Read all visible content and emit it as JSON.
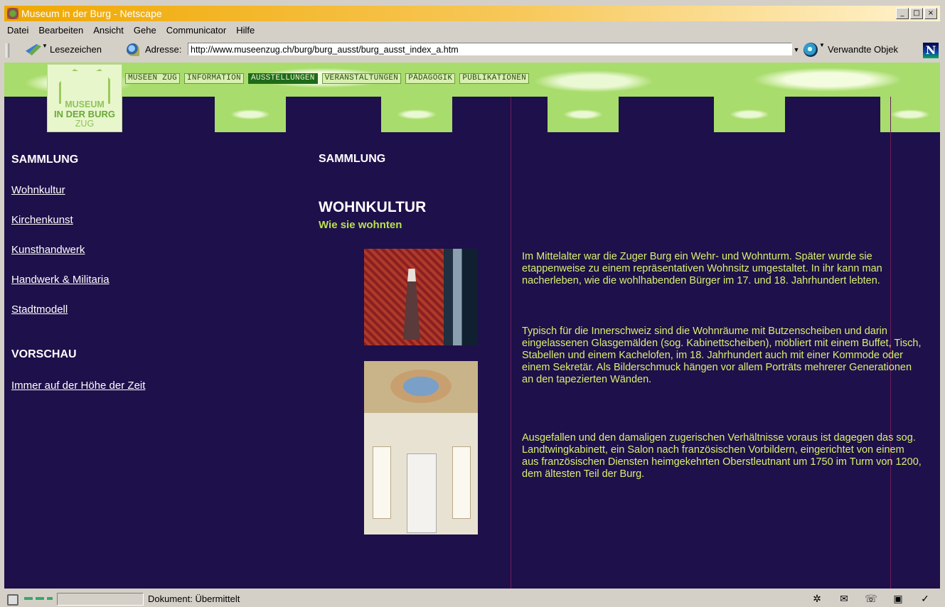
{
  "window": {
    "title": "Museum in der Burg - Netscape",
    "buttons": [
      "_",
      "□",
      "×"
    ]
  },
  "menu": [
    "Datei",
    "Bearbeiten",
    "Ansicht",
    "Gehe",
    "Communicator",
    "Hilfe"
  ],
  "toolbar": {
    "bookmarks_label": "Lesezeichen",
    "address_label": "Adresse:",
    "url": "http://www.museenzug.ch/burg/burg_ausst/burg_ausst_index_a.htm",
    "related_label": "Verwandte Objek",
    "brand_letter": "N"
  },
  "logo": {
    "line1": "MUSEUM",
    "line2": "IN DER BURG",
    "line3": "ZUG"
  },
  "nav": [
    "MUSEEN ZUG",
    "INFORMATION",
    "AUSSTELLUNGEN",
    "VERANSTALTUNGEN",
    "PÄDAGOGIK",
    "PUBLIKATIONEN"
  ],
  "nav_active": "AUSSTELLUNGEN",
  "left": {
    "heading1": "SAMMLUNG",
    "links": [
      "Wohnkultur",
      "Kirchenkunst",
      "Kunsthandwerk",
      "Handwerk & Militaria",
      "Stadtmodell"
    ],
    "heading2": "VORSCHAU",
    "preview_link": "Immer auf der Höhe der Zeit"
  },
  "main": {
    "section": "SAMMLUNG",
    "title": "WOHNKULTUR",
    "subtitle": "Wie sie wohnten",
    "paragraphs": [
      "Im Mittelalter war die Zuger Burg ein Wehr- und Wohnturm. Später wurde sie etappenweise zu einem repräsentativen Wohnsitz umgestaltet. In ihr kann man nacherleben, wie die wohlhabenden Bürger im 17. und 18. Jahrhundert lebten.",
      "Typisch für die Innerschweiz sind die Wohnräume mit Butzenscheiben und darin eingelassenen Glasgemälden (sog. Kabinettscheiben), möbliert mit einem Buffet, Tisch, Stabellen und einem Kachelofen, im 18. Jahrhundert auch mit einer Kommode oder einem Sekretär. Als Bilderschmuck hängen vor allem Porträts mehrerer Generationen an den tapezierten Wänden.",
      "Ausgefallen und den damaligen zugerischen Verhältnisse voraus ist dagegen das sog. Landtwingkabinett, ein Salon nach französischen Vorbildern, eingerichtet von einem aus französischen Diensten heimgekehrten Oberstleutnant um 1750 im Turm von 1200, dem ältesten Teil der Burg."
    ]
  },
  "status": {
    "text": "Dokument: Übermittelt"
  },
  "colors": {
    "page_bg": "#1e104a",
    "header_green": "#a8dc6c",
    "body_text": "#d8f070",
    "subtitle": "#b8e050",
    "titlebar": "#f0a800"
  }
}
